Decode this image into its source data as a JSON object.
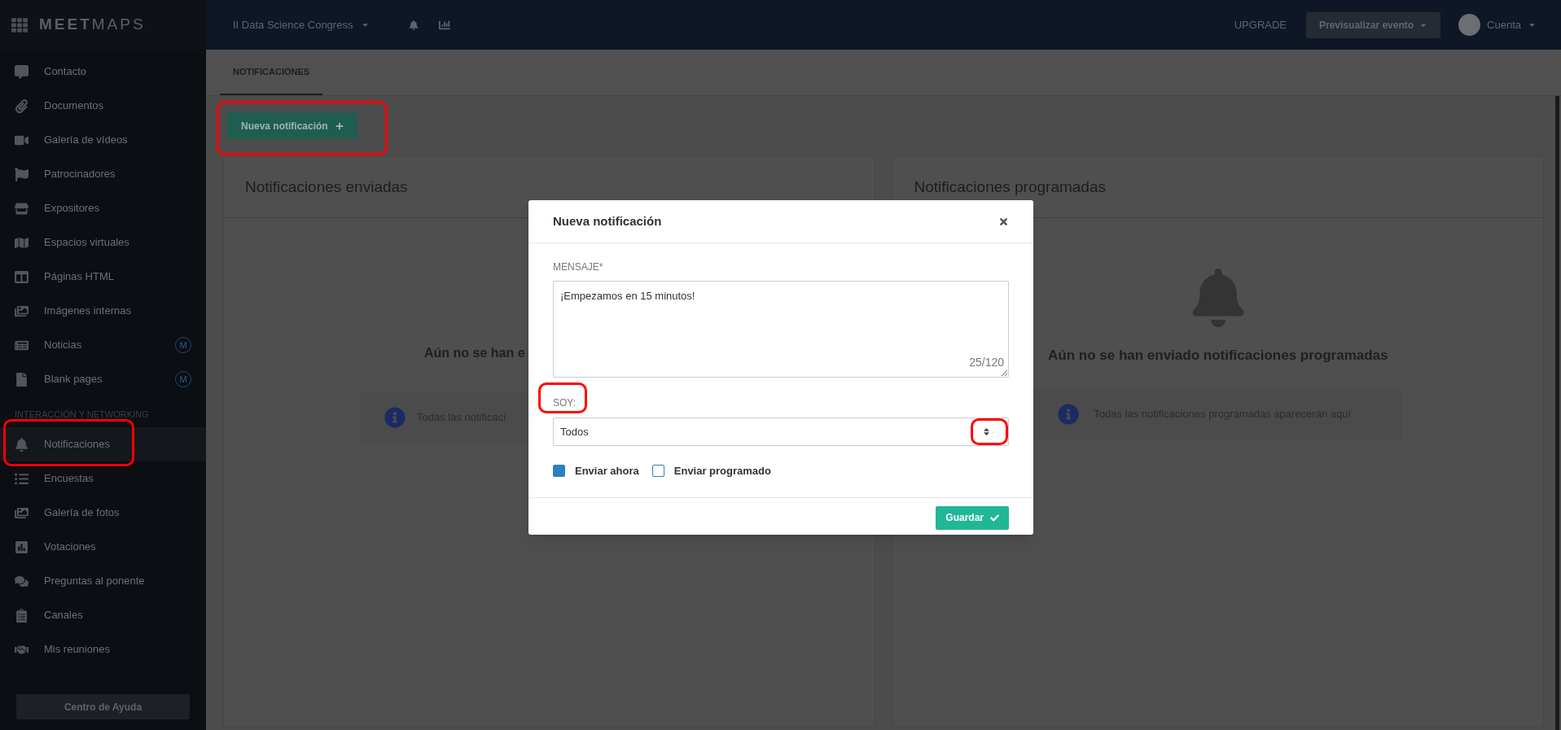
{
  "sidebar": {
    "logo": "**MEET**MAPS",
    "sections": [
      {
        "items": [
          {
            "label": "Contacto",
            "selected": false
          },
          {
            "label": "Documentos",
            "selected": false
          },
          {
            "label": "Galería de vídeos",
            "selected": false
          },
          {
            "label": "Patrocinadores",
            "selected": false
          },
          {
            "label": "Expositores",
            "selected": false
          },
          {
            "label": "Espacios virtuales",
            "selected": false
          },
          {
            "label": "Páginas HTML",
            "selected": false
          },
          {
            "label": "Imágenes internas",
            "selected": false
          },
          {
            "label": "Noticias",
            "selected": false,
            "badge": "M"
          },
          {
            "label": "Blank pages",
            "selected": false,
            "badge": "M"
          }
        ]
      },
      {
        "header": "INTERACCIÓN Y NETWORKING",
        "items": [
          {
            "label": "Notificaciones",
            "selected": true
          },
          {
            "label": "Encuestas",
            "selected": false
          },
          {
            "label": "Galería de fotos",
            "selected": false
          },
          {
            "label": "Votaciones",
            "selected": false
          },
          {
            "label": "Preguntas al ponente",
            "selected": false
          },
          {
            "label": "Canales",
            "selected": false
          },
          {
            "label": "Mis reuniones",
            "selected": false
          }
        ]
      }
    ],
    "help_button": "Centro de Ayuda"
  },
  "topbar": {
    "event": "II Data Science Congress",
    "upgrade": "UPGRADE",
    "preview_button": "Previsualizar evento",
    "account": "Cuenta"
  },
  "tabs": [
    {
      "label": "NOTIFICACIONES",
      "selected": true
    }
  ],
  "new_button": "Nueva notificación",
  "cards": [
    {
      "title": "Notificaciones enviadas",
      "empty_text": "Aún no se han e",
      "info_text": "Todas las notificaci"
    },
    {
      "title": "Notificaciones programadas",
      "empty_text": "Aún no se han enviado notificaciones programadas",
      "info_text": "Todas las notificaciones programadas aparecerán aquí"
    }
  ],
  "modal": {
    "title": "Nueva notificación",
    "message_label": "MENSAJE*",
    "message": "¡Empezamos en 15 minutos!",
    "counter": "25/120",
    "audience_label": "SOY:",
    "audience": "Todos",
    "options": [
      {
        "label": "Enviar ahora",
        "checked": true
      },
      {
        "label": "Enviar programado",
        "checked": false
      }
    ],
    "save_button": "Guardar"
  }
}
